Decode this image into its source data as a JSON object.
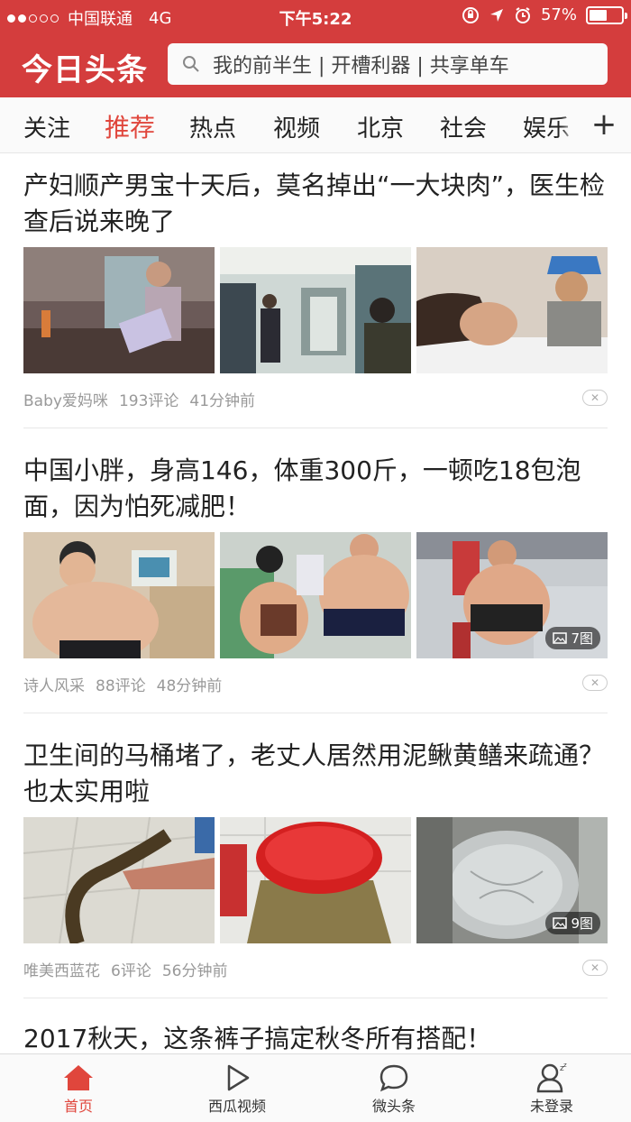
{
  "status_bar": {
    "carrier": "中国联通",
    "network": "4G",
    "time": "下午5:22",
    "battery_percent": "57%",
    "battery_level": 0.57
  },
  "header": {
    "logo_text": "今日头条",
    "search_placeholder": "我的前半生 | 开槽利器 | 共享单车",
    "brand_color": "#d43d3d"
  },
  "channels": {
    "items": [
      "关注",
      "推荐",
      "热点",
      "视频",
      "北京",
      "社会",
      "娱乐"
    ],
    "active_index": 1,
    "add_icon": "plus-icon"
  },
  "feed": [
    {
      "title": "产妇顺产男宝十天后，莫名掉出“一大块肉”，医生检查后说来晚了",
      "source": "Baby爱妈咪",
      "comments": "193评论",
      "time": "41分钟前",
      "image_count": ""
    },
    {
      "title": "中国小胖，身高146，体重300斤，一顿吃18包泡面，因为怕死减肥！",
      "source": "诗人风采",
      "comments": "88评论",
      "time": "48分钟前",
      "image_count": "7图"
    },
    {
      "title": "卫生间的马桶堵了，老丈人居然用泥鳅黄鳝来疏通？也太实用啦",
      "source": "唯美西蓝花",
      "comments": "6评论",
      "time": "56分钟前",
      "image_count": "9图"
    },
    {
      "title": "2017秋天，这条裤子搞定秋冬所有搭配！"
    }
  ],
  "bottom_nav": {
    "items": [
      {
        "label": "首页",
        "icon": "home-icon"
      },
      {
        "label": "西瓜视频",
        "icon": "play-icon"
      },
      {
        "label": "微头条",
        "icon": "chat-bubble-icon"
      },
      {
        "label": "未登录",
        "icon": "user-icon"
      }
    ],
    "active_index": 0,
    "active_color": "#e0463c"
  }
}
